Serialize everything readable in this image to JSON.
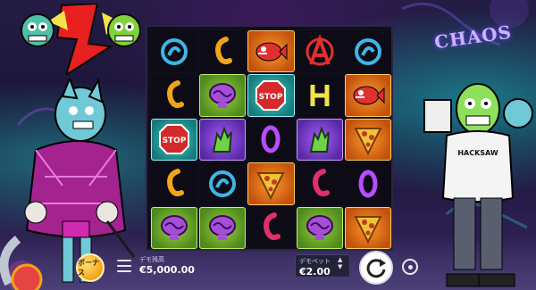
{
  "game": {
    "chaos_sign": "CHAOS",
    "shirt_text": "HACKSAW"
  },
  "colors": {
    "accent_yellow": "#f1a416",
    "neon_green": "#9ad23a",
    "neon_purple": "#a65cff",
    "neon_teal": "#3ad6d0"
  },
  "grid": {
    "rows": [
      [
        "spiral-blue",
        "hook-orange",
        "red-fish",
        "anarchy-red",
        "spiral-blue"
      ],
      [
        "hook-orange",
        "brain-purple",
        "stop-sign",
        "h-yellow",
        "red-fish"
      ],
      [
        "stop-sign",
        "zombie-hand",
        "zero-purple",
        "zombie-hand",
        "pizza-slice"
      ],
      [
        "hook-orange",
        "spiral-blue",
        "pizza-slice",
        "hook-red",
        "zero-purple"
      ],
      [
        "brain-purple",
        "brain-purple",
        "hook-red",
        "brain-purple",
        "pizza-slice"
      ]
    ]
  },
  "controls": {
    "bonus_label": "ボーナス",
    "balance_label": "デモ残高",
    "balance_value": "€5,000.00",
    "bet_label": "デモベット",
    "bet_value": "€2.00"
  },
  "icons": {
    "menu": "hamburger-icon",
    "spin": "spin-arrow-icon",
    "autoplay": "autoplay-icon"
  }
}
